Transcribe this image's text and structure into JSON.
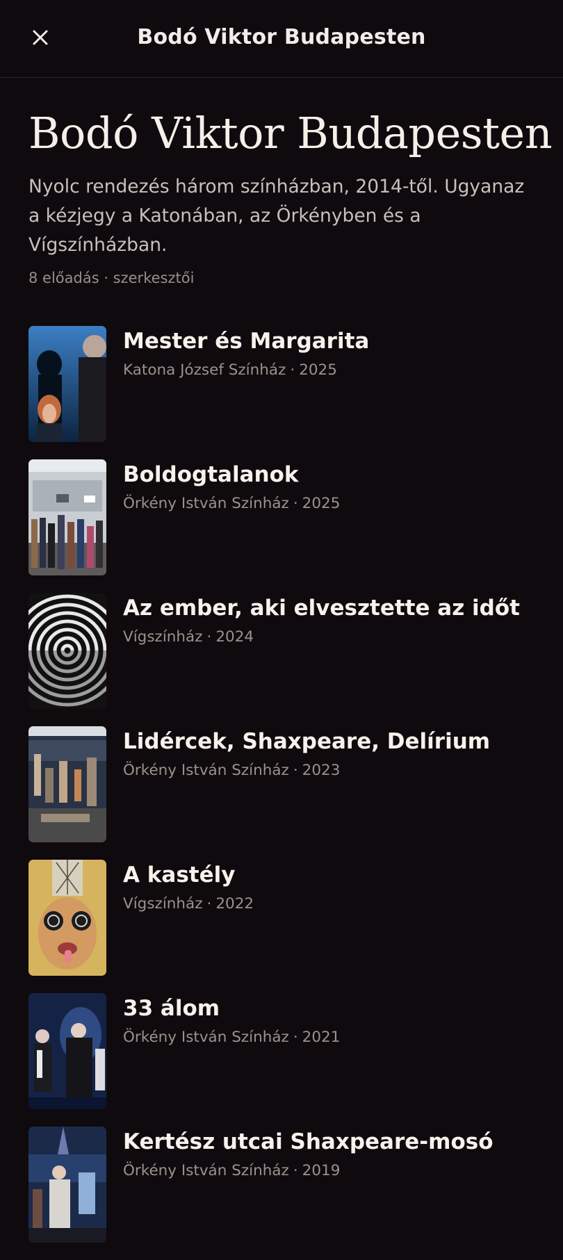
{
  "topbar": {
    "title": "Bodó Viktor Budapesten",
    "close_icon": "close-icon"
  },
  "hero": {
    "title": "Bodó Viktor Budapesten",
    "subtitle": "Nyolc rendezés három színházban, 2014-től. Ugyanaz a kézjegy a Katonában, az Örkényben és a Vígszínházban.",
    "meta": "8 előadás · szerkesztői"
  },
  "items": [
    {
      "title": "Mester és Margarita",
      "venue": "Katona József Színház",
      "year": "2025"
    },
    {
      "title": "Boldogtalanok",
      "venue": "Örkény István Színház",
      "year": "2025"
    },
    {
      "title": "Az ember, aki elvesztette az időt",
      "venue": "Vígszínház",
      "year": "2024"
    },
    {
      "title": "Lidércek, Shaxpeare, Delírium",
      "venue": "Örkény István Színház",
      "year": "2023"
    },
    {
      "title": "A kastély",
      "venue": "Vígszínház",
      "year": "2022"
    },
    {
      "title": "33 álom",
      "venue": "Örkény István Színház",
      "year": "2021"
    },
    {
      "title": "Kertész utcai Shaxpeare-mosó",
      "venue": "Örkény István Színház",
      "year": "2019"
    }
  ],
  "colors": {
    "background": "#0f0a0d",
    "text": "#f4ece9",
    "muted": "#9d918d"
  }
}
